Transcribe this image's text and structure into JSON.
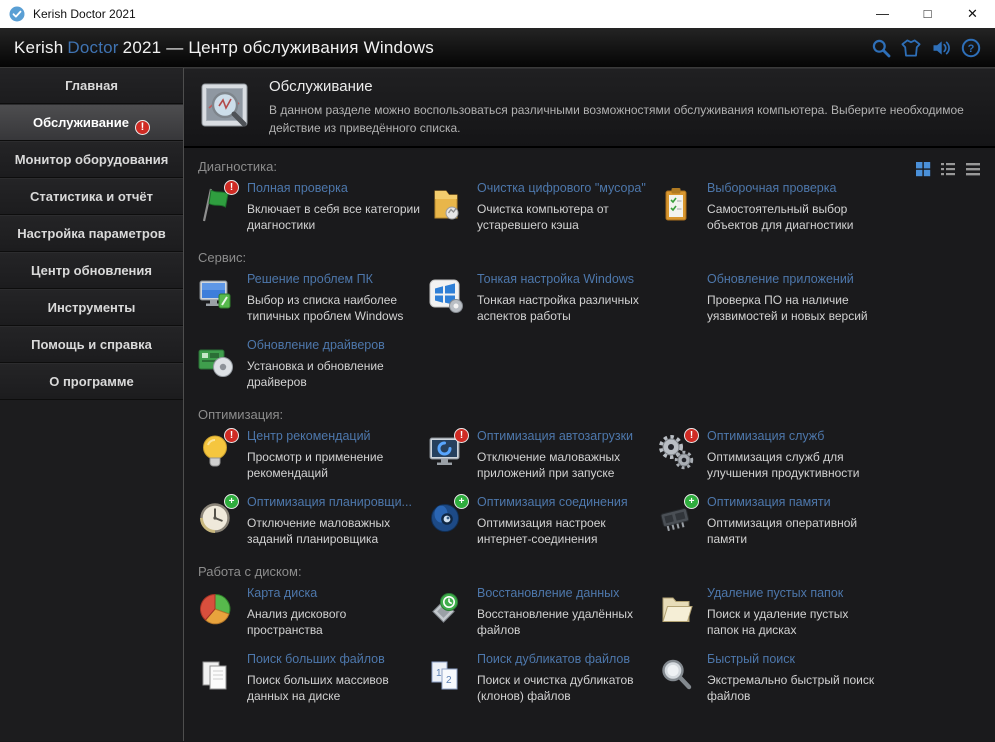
{
  "titlebar": {
    "title": "Kerish Doctor 2021",
    "minimize": "—",
    "maximize": "□",
    "close": "✕"
  },
  "appbar": {
    "brand_primary": "Kerish",
    "brand_accent": "Doctor",
    "brand_suffix": "2021 — Центр обслуживания Windows"
  },
  "sidebar": {
    "items": [
      {
        "label": "Главная",
        "active": false,
        "badge": false
      },
      {
        "label": "Обслуживание",
        "active": true,
        "badge": true
      },
      {
        "label": "Монитор оборудования",
        "active": false,
        "badge": false
      },
      {
        "label": "Статистика и отчёт",
        "active": false,
        "badge": false
      },
      {
        "label": "Настройка параметров",
        "active": false,
        "badge": false
      },
      {
        "label": "Центр обновления",
        "active": false,
        "badge": false
      },
      {
        "label": "Инструменты",
        "active": false,
        "badge": false
      },
      {
        "label": "Помощь и справка",
        "active": false,
        "badge": false
      },
      {
        "label": "О программе",
        "active": false,
        "badge": false
      }
    ]
  },
  "page_header": {
    "title": "Обслуживание",
    "description": "В данном разделе можно воспользоваться различными возможностями обслуживания компьютера. Выберите необходимое действие из приведённого списка."
  },
  "view_toggles": [
    {
      "name": "grid-view",
      "active": true
    },
    {
      "name": "list-view",
      "active": false
    },
    {
      "name": "details-view",
      "active": false
    }
  ],
  "sections": [
    {
      "label": "Диагностика:",
      "items": [
        {
          "icon": "flag-icon",
          "badge": "red",
          "title": "Полная проверка",
          "description": "Включает в себя все категории диагностики"
        },
        {
          "icon": "folder-cleanup-icon",
          "badge": null,
          "title": "Очистка цифрового \"мусора\"",
          "description": "Очистка компьютера от устаревшего кэша"
        },
        {
          "icon": "clipboard-icon",
          "badge": null,
          "title": "Выборочная проверка",
          "description": "Самостоятельный выбор объектов для диагностики"
        }
      ]
    },
    {
      "label": "Сервис:",
      "items": [
        {
          "icon": "monitor-repair-icon",
          "badge": null,
          "title": "Решение проблем ПК",
          "description": "Выбор из списка наиболее типичных проблем Windows"
        },
        {
          "icon": "windows-tweak-icon",
          "badge": null,
          "title": "Тонкая настройка Windows",
          "description": "Тонкая настройка различных аспектов работы"
        },
        {
          "icon": "none",
          "badge": null,
          "title": "Обновление приложений",
          "description": "Проверка ПО на наличие уязвимостей и новых версий"
        },
        {
          "icon": "driver-icon",
          "badge": null,
          "title": "Обновление драйверов",
          "description": "Установка и обновление драйверов"
        }
      ]
    },
    {
      "label": "Оптимизация:",
      "items": [
        {
          "icon": "bulb-icon",
          "badge": "red",
          "title": "Центр рекомендаций",
          "description": "Просмотр и применение рекомендаций"
        },
        {
          "icon": "monitor-startup-icon",
          "badge": "red",
          "title": "Оптимизация автозагрузки",
          "description": "Отключение маловажных приложений при запуске"
        },
        {
          "icon": "gears-icon",
          "badge": "red",
          "title": "Оптимизация служб",
          "description": "Оптимизация служб для улучшения продуктивности"
        },
        {
          "icon": "clock-icon",
          "badge": "green",
          "title": "Оптимизация планировщи...",
          "description": "Отключение маловажных заданий планировщика"
        },
        {
          "icon": "globe-icon",
          "badge": "green",
          "title": "Оптимизация соединения",
          "description": "Оптимизация настроек интернет-соединения"
        },
        {
          "icon": "memory-icon",
          "badge": "green",
          "title": "Оптимизация памяти",
          "description": "Оптимизация оперативной памяти"
        }
      ]
    },
    {
      "label": "Работа с диском:",
      "items": [
        {
          "icon": "piechart-icon",
          "badge": null,
          "title": "Карта диска",
          "description": "Анализ дискового пространства"
        },
        {
          "icon": "restore-icon",
          "badge": null,
          "title": "Восстановление данных",
          "description": "Восстановление удалённых файлов"
        },
        {
          "icon": "folder-icon",
          "badge": null,
          "title": "Удаление пустых папок",
          "description": "Поиск и удаление пустых папок на дисках"
        },
        {
          "icon": "documents-icon",
          "badge": null,
          "title": "Поиск больших файлов",
          "description": "Поиск больших массивов данных на диске"
        },
        {
          "icon": "duplicates-icon",
          "badge": null,
          "title": "Поиск дубликатов файлов",
          "description": "Поиск и очистка дубликатов (клонов) файлов"
        },
        {
          "icon": "file-search-icon",
          "badge": null,
          "title": "Быстрый поиск",
          "description": "Экстремально быстрый поиск файлов"
        }
      ]
    }
  ],
  "colors": {
    "link_blue": "#4d77ab",
    "brand_blue": "#3f73b2",
    "icon_blue": "#2e6fb8",
    "badge_red": "#cf2b24",
    "badge_green": "#2fae3e"
  }
}
